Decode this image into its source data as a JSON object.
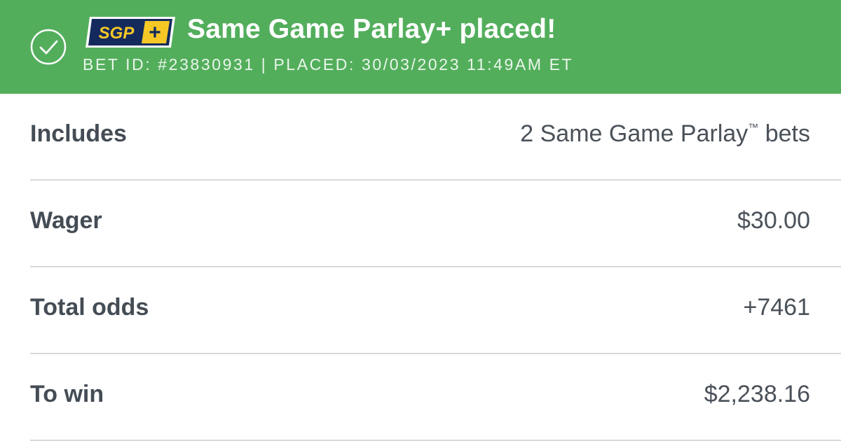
{
  "header": {
    "badge_text_left": "SGP",
    "badge_text_right": "+",
    "title": "Same Game Parlay+ placed!",
    "meta": "BET ID: #23830931 | PLACED: 30/03/2023 11:49AM ET",
    "status_icon": "check-circle-icon",
    "background_color": "#53ae5c",
    "badge_navy": "#142a5c",
    "badge_yellow": "#f5c826"
  },
  "summary": {
    "rows": [
      {
        "label": "Includes",
        "value": "2 Same Game Parlay",
        "value_suffix": "™",
        "value_tail": " bets"
      },
      {
        "label": "Wager",
        "value": "$30.00"
      },
      {
        "label": "Total odds",
        "value": "+7461"
      },
      {
        "label": "To win",
        "value": "$2,238.16"
      }
    ]
  }
}
